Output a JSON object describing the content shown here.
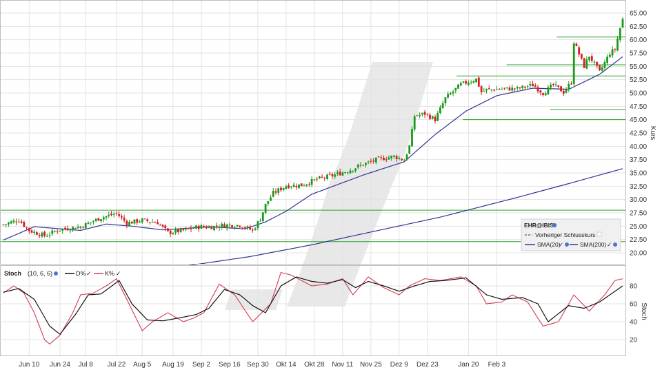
{
  "chart_data": [
    {
      "type": "candlestick",
      "ylabel": "Kurs",
      "ylim": [
        17.5,
        66.5
      ],
      "yticks": [
        "65.00",
        "62.50",
        "60.00",
        "57.50",
        "55.00",
        "52.50",
        "50.00",
        "47.50",
        "45.00",
        "42.50",
        "40.00",
        "37.50",
        "35.00",
        "32.50",
        "30.00",
        "27.50",
        "25.00",
        "22.50",
        "20.00"
      ],
      "legend": {
        "symbol": "EHR@IBIS",
        "prev_close": "Vorheriger Schlusskurs",
        "sma20": "SMA(20)",
        "sma200": "SMA(200)"
      },
      "colors": {
        "up": "#1a9a1a",
        "down": "#d42020",
        "sma20": "#2d3593",
        "sma200": "#2d3593",
        "support": "#2ca02c",
        "grid": "#e3e3e3"
      },
      "horizontal_lines": [
        {
          "y": 28.0,
          "from": 0,
          "to": 1
        },
        {
          "y": 22.1,
          "from": 0,
          "to": 1
        },
        {
          "y": 53.2,
          "from": 0.73,
          "to": 1
        },
        {
          "y": 55.3,
          "from": 0.81,
          "to": 1
        },
        {
          "y": 60.5,
          "from": 0.89,
          "to": 1
        },
        {
          "y": 46.9,
          "from": 0.88,
          "to": 1
        },
        {
          "y": 45.0,
          "from": 0.74,
          "to": 1
        }
      ],
      "anchors": [
        [
          0,
          25.3
        ],
        [
          6,
          26.2
        ],
        [
          10,
          24.2
        ],
        [
          16,
          23.2
        ],
        [
          22,
          24.4
        ],
        [
          30,
          24.9
        ],
        [
          38,
          26.6
        ],
        [
          44,
          27.4
        ],
        [
          48,
          25.6
        ],
        [
          54,
          26.1
        ],
        [
          60,
          25.7
        ],
        [
          64,
          23.8
        ],
        [
          70,
          24.2
        ],
        [
          76,
          24.9
        ],
        [
          80,
          24.8
        ],
        [
          86,
          25.2
        ],
        [
          92,
          25.2
        ],
        [
          97,
          24.2
        ],
        [
          100,
          26.4
        ],
        [
          102,
          29.0
        ],
        [
          105,
          31.2
        ],
        [
          110,
          32.6
        ],
        [
          116,
          32.7
        ],
        [
          122,
          33.8
        ],
        [
          128,
          34.5
        ],
        [
          134,
          35.4
        ],
        [
          140,
          36.6
        ],
        [
          146,
          37.6
        ],
        [
          152,
          38.1
        ],
        [
          156,
          37.4
        ],
        [
          158,
          40.0
        ],
        [
          160,
          45.7
        ],
        [
          164,
          46.1
        ],
        [
          168,
          45.0
        ],
        [
          172,
          49.0
        ],
        [
          178,
          51.6
        ],
        [
          184,
          52.6
        ],
        [
          186,
          50.2
        ],
        [
          188,
          50.6
        ],
        [
          194,
          50.8
        ],
        [
          200,
          50.8
        ],
        [
          206,
          51.5
        ],
        [
          210,
          50.0
        ],
        [
          214,
          51.5
        ],
        [
          218,
          50.2
        ],
        [
          221,
          52.0
        ],
        [
          222,
          59.6
        ],
        [
          226,
          55.0
        ],
        [
          228,
          57.0
        ],
        [
          232,
          53.9
        ],
        [
          236,
          57.5
        ],
        [
          238,
          58.2
        ],
        [
          240,
          62.2
        ],
        [
          241,
          63.8
        ]
      ],
      "sma20_anchors": [
        [
          0,
          22.4
        ],
        [
          12,
          24.9
        ],
        [
          30,
          24.2
        ],
        [
          40,
          25.4
        ],
        [
          50,
          25.0
        ],
        [
          62,
          24.3
        ],
        [
          80,
          24.9
        ],
        [
          94,
          24.5
        ],
        [
          102,
          25.8
        ],
        [
          110,
          27.8
        ],
        [
          120,
          31.0
        ],
        [
          140,
          34.6
        ],
        [
          156,
          37.1
        ],
        [
          168,
          42.2
        ],
        [
          180,
          46.6
        ],
        [
          192,
          49.5
        ],
        [
          206,
          50.9
        ],
        [
          220,
          50.7
        ],
        [
          232,
          53.5
        ],
        [
          241,
          56.8
        ]
      ],
      "sma200_anchors": [
        [
          72,
          17.6
        ],
        [
          96,
          19.3
        ],
        [
          120,
          21.5
        ],
        [
          140,
          23.6
        ],
        [
          170,
          26.7
        ],
        [
          200,
          30.4
        ],
        [
          220,
          33.0
        ],
        [
          241,
          35.8
        ]
      ]
    },
    {
      "type": "line",
      "title": "Stoch",
      "params": "(10, 6, 6)",
      "series_names": [
        "D%",
        "K%"
      ],
      "ylabel": "Stoch",
      "ylim": [
        5,
        95
      ],
      "yticks": [
        "80",
        "60",
        "40",
        "20"
      ],
      "colors": {
        "D": "#111111",
        "K": "#d43a50"
      },
      "D_anchors": [
        [
          0,
          73
        ],
        [
          6,
          77
        ],
        [
          12,
          65
        ],
        [
          18,
          35
        ],
        [
          22,
          26
        ],
        [
          28,
          48
        ],
        [
          33,
          70
        ],
        [
          38,
          71
        ],
        [
          45,
          86
        ],
        [
          50,
          60
        ],
        [
          56,
          42
        ],
        [
          62,
          41
        ],
        [
          68,
          44
        ],
        [
          75,
          48
        ],
        [
          80,
          55
        ],
        [
          86,
          76
        ],
        [
          92,
          70
        ],
        [
          97,
          58
        ],
        [
          102,
          50
        ],
        [
          108,
          80
        ],
        [
          114,
          90
        ],
        [
          120,
          85
        ],
        [
          126,
          83
        ],
        [
          132,
          87
        ],
        [
          137,
          78
        ],
        [
          142,
          85
        ],
        [
          148,
          80
        ],
        [
          154,
          74
        ],
        [
          160,
          80
        ],
        [
          166,
          85
        ],
        [
          172,
          86
        ],
        [
          180,
          89
        ],
        [
          188,
          70
        ],
        [
          194,
          65
        ],
        [
          202,
          67
        ],
        [
          208,
          60
        ],
        [
          212,
          40
        ],
        [
          220,
          58
        ],
        [
          226,
          55
        ],
        [
          232,
          62
        ],
        [
          241,
          80
        ]
      ],
      "K_anchors": [
        [
          0,
          72
        ],
        [
          4,
          80
        ],
        [
          8,
          72
        ],
        [
          12,
          50
        ],
        [
          16,
          20
        ],
        [
          18,
          15
        ],
        [
          22,
          25
        ],
        [
          27,
          50
        ],
        [
          30,
          70
        ],
        [
          35,
          72
        ],
        [
          40,
          80
        ],
        [
          44,
          88
        ],
        [
          48,
          65
        ],
        [
          54,
          30
        ],
        [
          58,
          40
        ],
        [
          64,
          50
        ],
        [
          70,
          40
        ],
        [
          74,
          44
        ],
        [
          78,
          50
        ],
        [
          84,
          82
        ],
        [
          90,
          70
        ],
        [
          97,
          40
        ],
        [
          104,
          60
        ],
        [
          108,
          95
        ],
        [
          112,
          92
        ],
        [
          120,
          80
        ],
        [
          126,
          82
        ],
        [
          132,
          88
        ],
        [
          136,
          70
        ],
        [
          142,
          90
        ],
        [
          148,
          78
        ],
        [
          154,
          70
        ],
        [
          158,
          80
        ],
        [
          164,
          88
        ],
        [
          170,
          86
        ],
        [
          178,
          90
        ],
        [
          184,
          80
        ],
        [
          188,
          60
        ],
        [
          194,
          62
        ],
        [
          198,
          70
        ],
        [
          204,
          62
        ],
        [
          210,
          35
        ],
        [
          216,
          40
        ],
        [
          222,
          70
        ],
        [
          228,
          52
        ],
        [
          234,
          70
        ],
        [
          238,
          86
        ],
        [
          241,
          88
        ]
      ]
    }
  ],
  "x_axis": {
    "count": 242,
    "labels": [
      {
        "i": 10,
        "text": "Jun 10"
      },
      {
        "i": 22,
        "text": "Jun 24"
      },
      {
        "i": 32,
        "text": "Jul 8"
      },
      {
        "i": 44,
        "text": "Jul 22"
      },
      {
        "i": 54,
        "text": "Aug 5"
      },
      {
        "i": 66,
        "text": "Aug 19"
      },
      {
        "i": 77,
        "text": "Sep 2"
      },
      {
        "i": 88,
        "text": "Sep 16"
      },
      {
        "i": 99,
        "text": "Sep 30"
      },
      {
        "i": 110,
        "text": "Okt 14"
      },
      {
        "i": 121,
        "text": "Okt 28"
      },
      {
        "i": 132,
        "text": "Nov 11"
      },
      {
        "i": 143,
        "text": "Nov 25"
      },
      {
        "i": 154,
        "text": "Dez 9"
      },
      {
        "i": 165,
        "text": "Dez 23"
      },
      {
        "i": 181,
        "text": "Jan 20"
      },
      {
        "i": 192,
        "text": "Feb 3"
      }
    ]
  }
}
